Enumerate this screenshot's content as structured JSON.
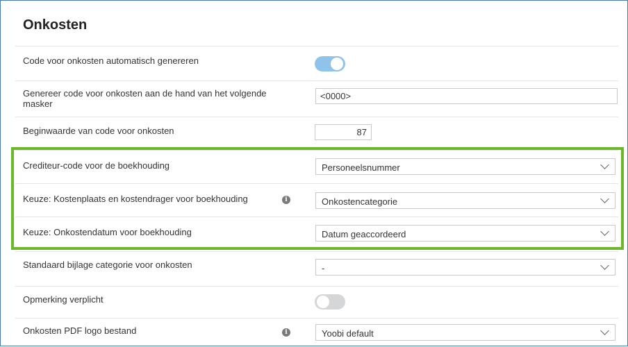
{
  "section": {
    "title": "Onkosten"
  },
  "settings": {
    "auto_generate": {
      "label": "Code voor onkosten automatisch genereren",
      "state": "on"
    },
    "mask": {
      "label": "Genereer code voor onkosten aan de hand van het volgende masker",
      "value": "<0000>"
    },
    "start_value": {
      "label": "Beginwaarde van code voor onkosten",
      "value": "87"
    },
    "creditor_code": {
      "label": "Crediteur-code voor de boekhouding",
      "value": "Personeelsnummer"
    },
    "cost_center": {
      "label": "Keuze: Kostenplaats en kostendrager voor boekhouding",
      "value": "Onkostencategorie",
      "info": "i"
    },
    "expense_date": {
      "label": "Keuze: Onkostendatum voor boekhouding",
      "value": "Datum geaccordeerd"
    },
    "attachment_category": {
      "label": "Standaard bijlage categorie voor onkosten",
      "value": "-"
    },
    "remark_required": {
      "label": "Opmerking verplicht",
      "state": "off"
    },
    "pdf_logo": {
      "label": "Onkosten PDF logo bestand",
      "value": "Yoobi default",
      "info": "i"
    }
  },
  "colors": {
    "highlight": "#6ab82a",
    "toggle_on": "#8fc3ea",
    "toggle_off": "#d5d6d8"
  }
}
